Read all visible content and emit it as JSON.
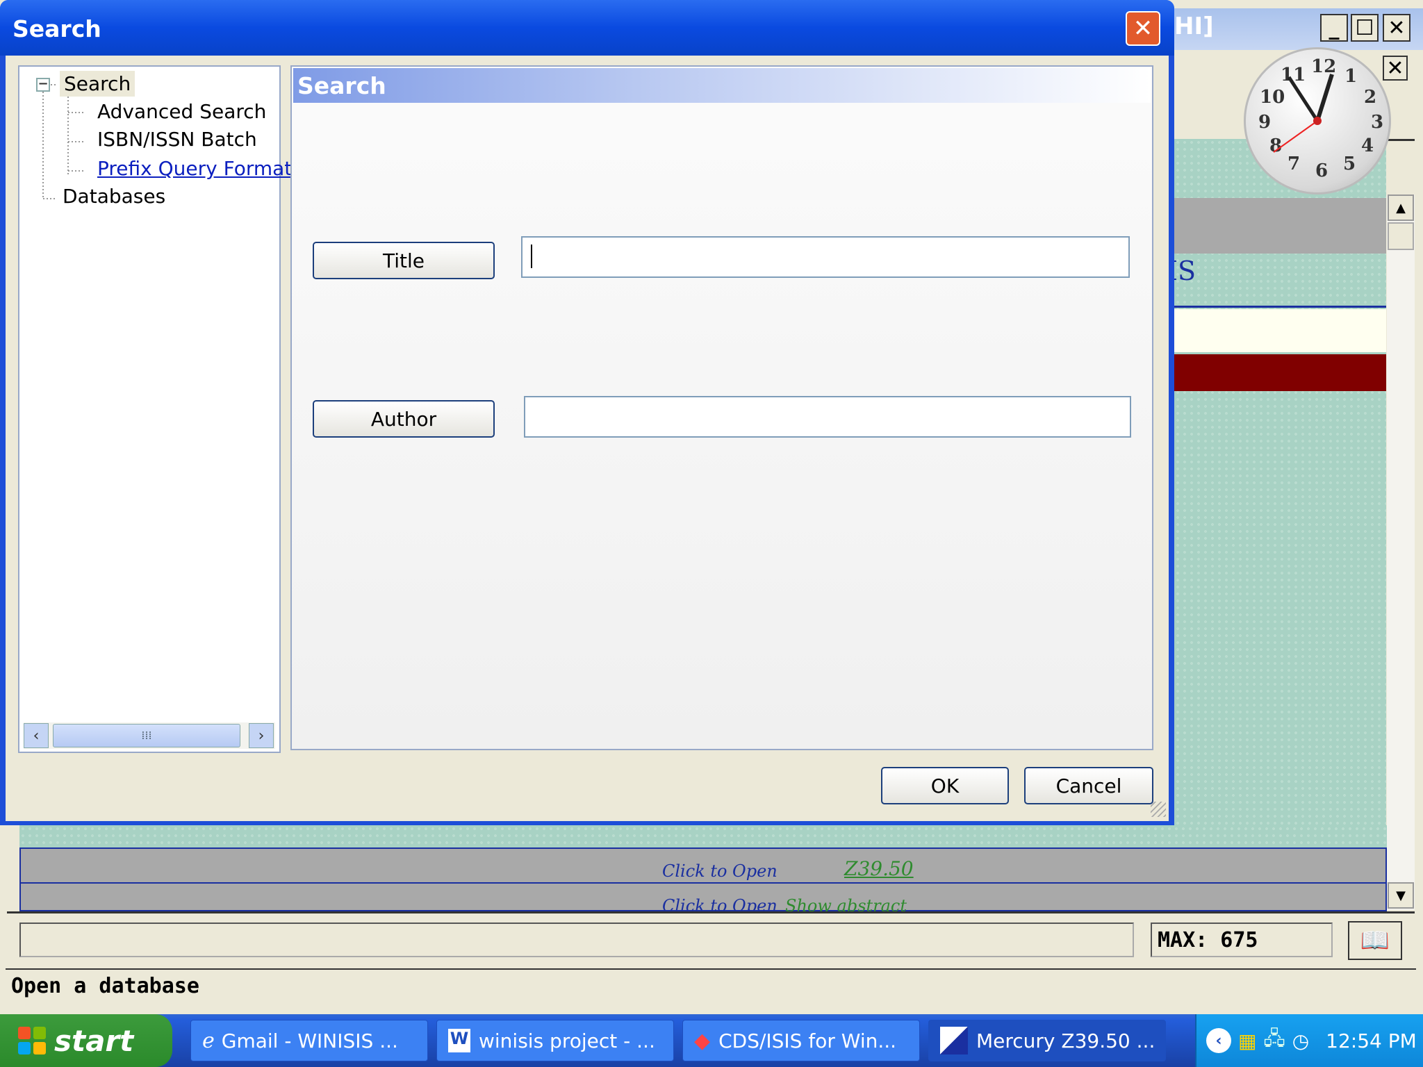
{
  "dialog": {
    "title": "Search",
    "panel_title": "Search",
    "close_icon": "close-icon",
    "tree": {
      "root": "Search",
      "items": [
        "Advanced Search",
        "ISBN/ISSN Batch",
        "Prefix Query Format"
      ],
      "databases": "Databases"
    },
    "fields": [
      {
        "button": "Title",
        "value": ""
      },
      {
        "button": "Author",
        "value": ""
      }
    ],
    "ok_label": "OK",
    "cancel_label": "Cancel"
  },
  "background_app": {
    "title_fragment": "HI]",
    "heading_fragment": "IS",
    "rows": [
      {
        "link": "Click to Open",
        "green": "Z39.50"
      },
      {
        "link": "Click to Open",
        "green": "Show abstract"
      }
    ],
    "max_label": "MAX: 675",
    "status_text": "Open a database",
    "clock_numbers": [
      "12",
      "1",
      "2",
      "3",
      "4",
      "5",
      "6",
      "7",
      "8",
      "9",
      "10",
      "11"
    ]
  },
  "taskbar": {
    "start_label": "start",
    "tasks": [
      {
        "label": "Gmail - WINISIS ...",
        "icon": "ie-icon"
      },
      {
        "label": "winisis project - ...",
        "icon": "word-icon"
      },
      {
        "label": "CDS/ISIS for Win...",
        "icon": "cds-isis-icon"
      },
      {
        "label": "Mercury Z39.50 ...",
        "icon": "mercury-icon"
      }
    ],
    "time": "12:54 PM"
  },
  "colors": {
    "xp_blue": "#0a4ae0",
    "dark_red": "#800000",
    "teal_bg": "#a8d2c4",
    "link_blue": "#1a2fa0",
    "green": "#2e8b2e"
  }
}
